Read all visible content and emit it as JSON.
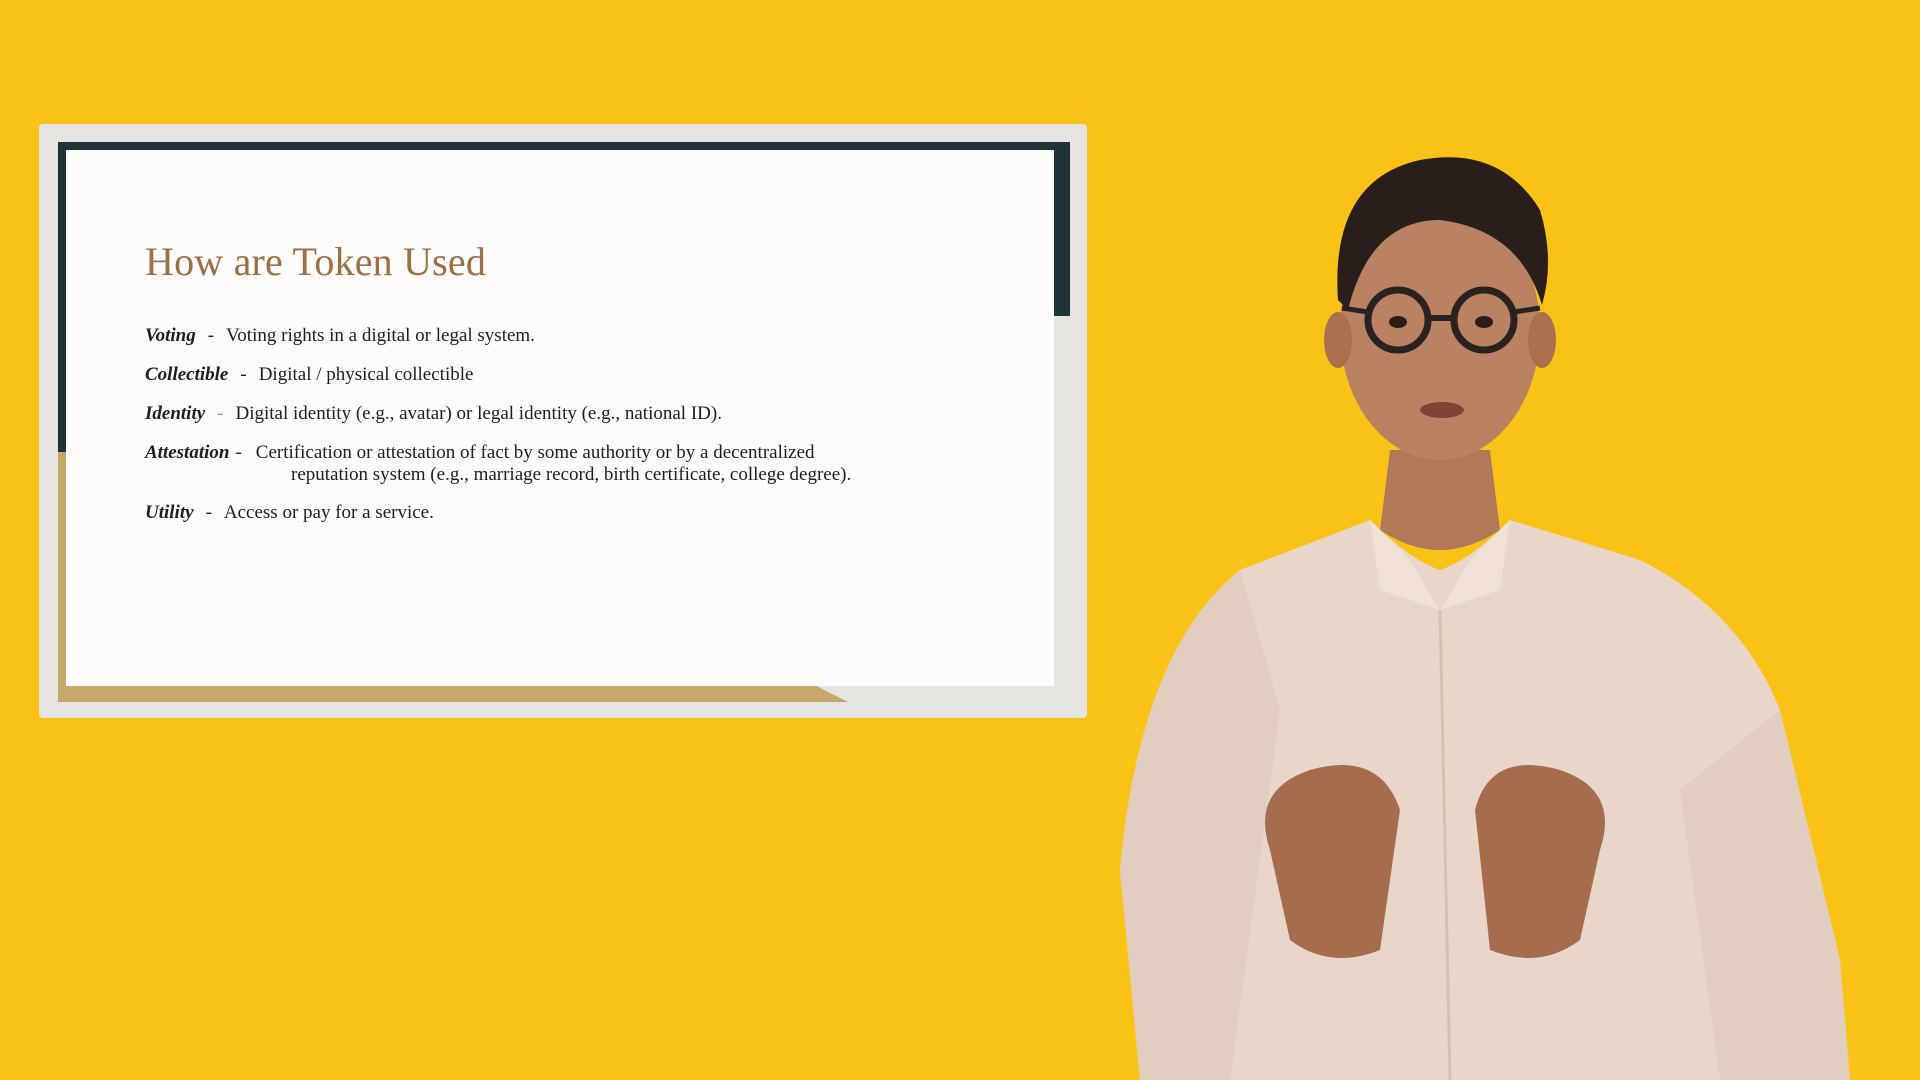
{
  "slide": {
    "title": "How are Token Used",
    "items": [
      {
        "term": "Voting",
        "dash": "-",
        "desc": "Voting rights in a digital or legal system."
      },
      {
        "term": "Collectible",
        "dash": "-",
        "desc": "Digital / physical collectible"
      },
      {
        "term": "Identity",
        "dash": "-",
        "desc": "Digital identity (e.g., avatar) or legal identity (e.g., national ID)."
      },
      {
        "term": "Attestation",
        "dash": "-",
        "desc": "Certification or attestation of fact by some authority or by a decentralized",
        "desc_cont": "reputation system (e.g., marriage record, birth certificate, college degree)."
      },
      {
        "term": "Utility",
        "dash": "-",
        "desc": "Access or pay for a service."
      }
    ]
  },
  "colors": {
    "background": "#F8C316",
    "title": "#9B7044",
    "dark_accent": "#1F3438",
    "gold_accent": "#C7A76B"
  },
  "presenter": {
    "icon": "presenter-figure"
  }
}
